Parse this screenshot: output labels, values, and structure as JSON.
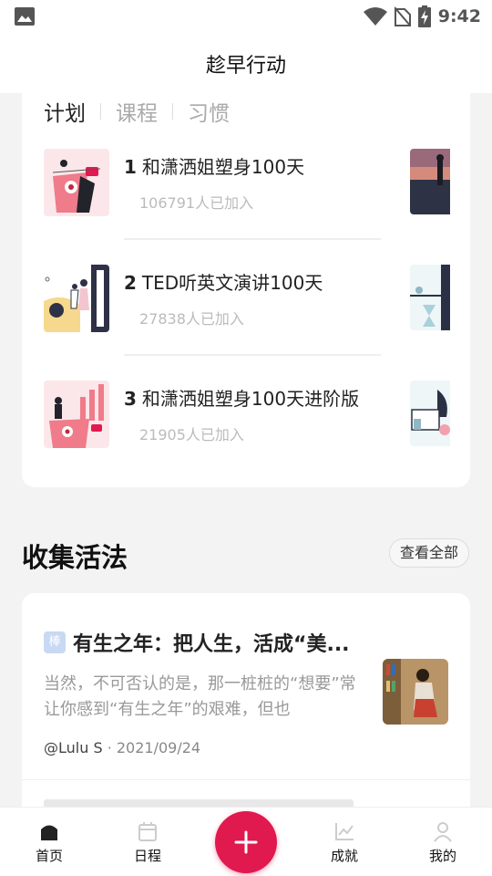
{
  "status_bar": {
    "time": "9:42"
  },
  "header": {
    "title": "趁早行动"
  },
  "tabs": [
    {
      "label": "计划"
    },
    {
      "label": "课程"
    },
    {
      "label": "习惯"
    }
  ],
  "plans": [
    {
      "num": "1",
      "name": "和潇洒姐塑身100天",
      "count": "106791人已加入"
    },
    {
      "num": "2",
      "name": "TED听英文演讲100天",
      "count": "27838人已加入"
    },
    {
      "num": "3",
      "name": "和潇洒姐塑身100天进阶版",
      "count": "21905人已加入"
    }
  ],
  "collection": {
    "title": "收集活法",
    "view_all": "查看全部",
    "article": {
      "badge": "棒",
      "title": "有生之年：把人生，活成“美...",
      "excerpt": "当然，不可否认的是，那一桩桩的“想要”常让你感到“有生之年”的艰难，但也",
      "author": "@Lulu S",
      "date": " · 2021/09/24"
    }
  },
  "bottom_nav": {
    "home": "首页",
    "schedule": "日程",
    "achievement": "成就",
    "profile": "我的"
  },
  "colors": {
    "accent": "#e0194f"
  }
}
